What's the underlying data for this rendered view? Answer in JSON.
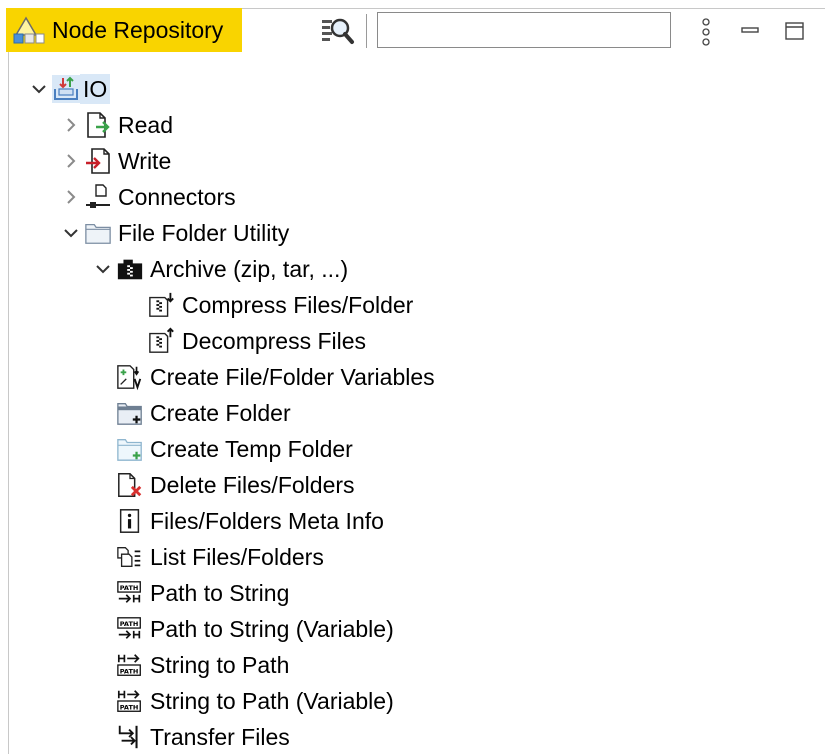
{
  "view": {
    "title": "Node Repository",
    "search_placeholder": "",
    "accent_color": "#f9d400"
  },
  "toolbar": {
    "search_icon": "search-icon",
    "menu_icon": "view-menu-icon",
    "minimize_icon": "minimize-icon",
    "maximize_icon": "maximize-icon"
  },
  "tree": [
    {
      "label": "IO",
      "depth": 0,
      "expand": "expanded",
      "icon": "io-category-icon"
    },
    {
      "label": "Read",
      "depth": 1,
      "expand": "collapsed",
      "icon": "read-icon"
    },
    {
      "label": "Write",
      "depth": 1,
      "expand": "collapsed",
      "icon": "write-icon"
    },
    {
      "label": "Connectors",
      "depth": 1,
      "expand": "collapsed",
      "icon": "connectors-icon"
    },
    {
      "label": "File Folder Utility",
      "depth": 1,
      "expand": "expanded",
      "icon": "folder-icon"
    },
    {
      "label": "Archive (zip, tar, ...)",
      "depth": 2,
      "expand": "expanded",
      "icon": "archive-icon"
    },
    {
      "label": "Compress Files/Folder",
      "depth": 3,
      "expand": "none",
      "icon": "compress-icon"
    },
    {
      "label": "Decompress Files",
      "depth": 3,
      "expand": "none",
      "icon": "decompress-icon"
    },
    {
      "label": "Create File/Folder Variables",
      "depth": 2,
      "expand": "none",
      "icon": "file-variables-icon"
    },
    {
      "label": "Create Folder",
      "depth": 2,
      "expand": "none",
      "icon": "create-folder-icon"
    },
    {
      "label": "Create Temp Folder",
      "depth": 2,
      "expand": "none",
      "icon": "temp-folder-icon"
    },
    {
      "label": "Delete Files/Folders",
      "depth": 2,
      "expand": "none",
      "icon": "delete-file-icon"
    },
    {
      "label": "Files/Folders Meta Info",
      "depth": 2,
      "expand": "none",
      "icon": "info-icon"
    },
    {
      "label": "List Files/Folders",
      "depth": 2,
      "expand": "none",
      "icon": "list-files-icon"
    },
    {
      "label": "Path to String",
      "depth": 2,
      "expand": "none",
      "icon": "path-to-string-icon"
    },
    {
      "label": "Path to String (Variable)",
      "depth": 2,
      "expand": "none",
      "icon": "path-to-string-icon"
    },
    {
      "label": "String to Path",
      "depth": 2,
      "expand": "none",
      "icon": "string-to-path-icon"
    },
    {
      "label": "String to Path (Variable)",
      "depth": 2,
      "expand": "none",
      "icon": "string-to-path-icon"
    },
    {
      "label": "Transfer Files",
      "depth": 2,
      "expand": "none",
      "icon": "transfer-files-icon"
    }
  ],
  "selected_index": 0
}
